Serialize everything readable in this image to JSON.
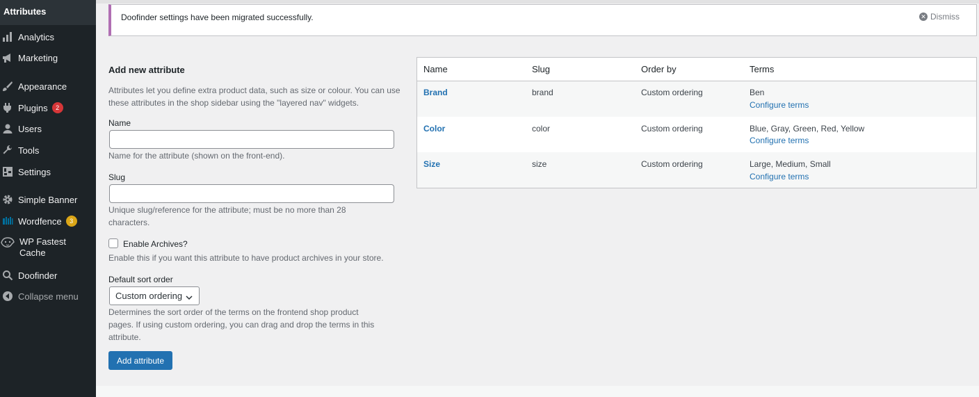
{
  "sidebar": {
    "current": "Attributes",
    "items": [
      {
        "label": "Analytics",
        "icon": "bar-chart-icon"
      },
      {
        "label": "Marketing",
        "icon": "megaphone-icon"
      },
      {
        "label": "Appearance",
        "icon": "paintbrush-icon"
      },
      {
        "label": "Plugins",
        "icon": "plugin-icon",
        "badge": "2"
      },
      {
        "label": "Users",
        "icon": "user-icon"
      },
      {
        "label": "Tools",
        "icon": "wrench-icon"
      },
      {
        "label": "Settings",
        "icon": "settings-icon"
      },
      {
        "label": "Simple Banner",
        "icon": "gear-icon"
      },
      {
        "label": "Wordfence",
        "icon": "wordfence-icon",
        "badge": "3"
      },
      {
        "label": "WP Fastest",
        "label2": "Cache",
        "icon": "cheetah-icon"
      },
      {
        "label": "Doofinder",
        "icon": "search-icon"
      },
      {
        "label": "Collapse menu",
        "icon": "collapse-icon"
      }
    ]
  },
  "notice": {
    "text": "Doofinder settings have been migrated successfully.",
    "dismiss": "Dismiss"
  },
  "form": {
    "title": "Add new attribute",
    "intro_line1": "Attributes let you define extra product data, such as size or colour. You can use",
    "intro_line2": "these attributes in the shop sidebar using the \"layered nav\" widgets.",
    "name_label": "Name",
    "name_value": "",
    "name_help": "Name for the attribute (shown on the front-end).",
    "slug_label": "Slug",
    "slug_value": "",
    "slug_help_line1": "Unique slug/reference for the attribute; must be no more than 28",
    "slug_help_line2": "characters.",
    "archives_label": "Enable Archives?",
    "archives_help": "Enable this if you want this attribute to have product archives in your store.",
    "sort_label": "Default sort order",
    "sort_value": "Custom ordering",
    "sort_help_line1": "Determines the sort order of the terms on the frontend shop product",
    "sort_help_line2": "pages. If using custom ordering, you can drag and drop the terms in this",
    "sort_help_line3": "attribute.",
    "submit_label": "Add attribute"
  },
  "table": {
    "headers": [
      "Name",
      "Slug",
      "Order by",
      "Terms"
    ],
    "rows": [
      {
        "name": "Brand",
        "slug": "brand",
        "order": "Custom ordering",
        "terms": "Ben",
        "link": "Configure terms"
      },
      {
        "name": "Color",
        "slug": "color",
        "order": "Custom ordering",
        "terms": "Blue, Gray, Green, Red, Yellow",
        "link": "Configure terms"
      },
      {
        "name": "Size",
        "slug": "size",
        "order": "Custom ordering",
        "terms": "Large, Medium, Small",
        "link": "Configure terms"
      }
    ]
  },
  "colors": {
    "sidebar_bg": "#1d2327",
    "accent": "#2271b1",
    "badge_red": "#d63638",
    "badge_yellow": "#dba617",
    "notice_border": "#b06fb3"
  }
}
